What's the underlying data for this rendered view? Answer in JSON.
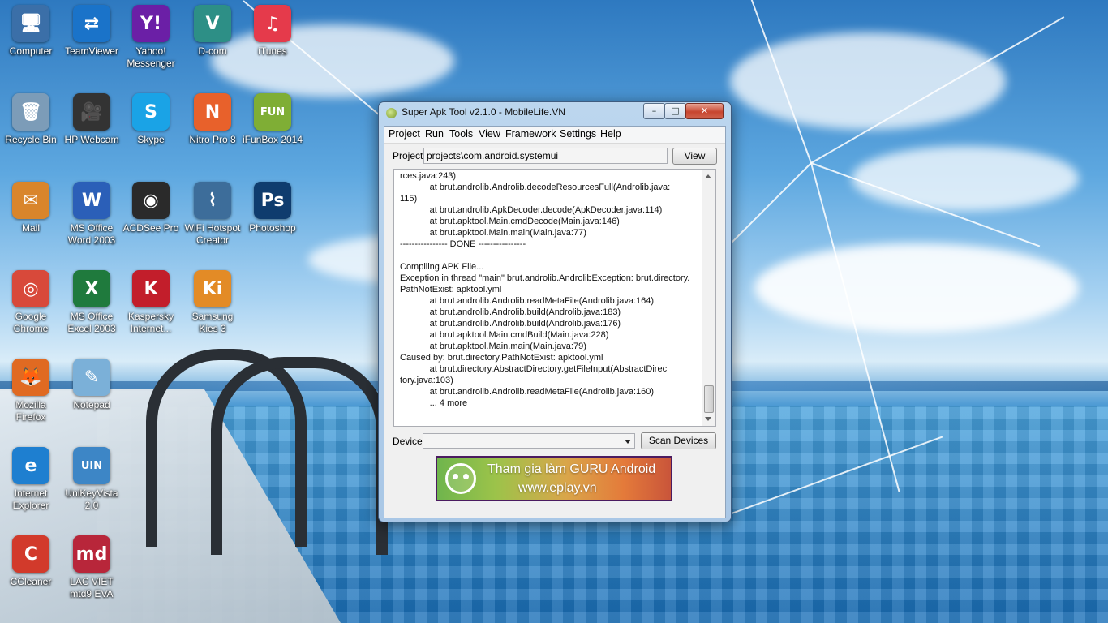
{
  "desktop": {
    "icons": [
      {
        "label": "Computer",
        "glyph": "🖥",
        "color": "#3b6fa8",
        "icon": "computer-icon"
      },
      {
        "label": "TeamViewer",
        "glyph": "⇄",
        "color": "#1a73c9",
        "icon": "teamviewer-icon"
      },
      {
        "label": "Yahoo!\nMessenger",
        "glyph": "Y!",
        "color": "#6b1fa6",
        "icon": "yahoo-messenger-icon"
      },
      {
        "label": "D-com",
        "glyph": "V",
        "color": "#2d8f86",
        "icon": "dcom-icon"
      },
      {
        "label": "iTunes",
        "glyph": "♫",
        "color": "#e53a4b",
        "icon": "itunes-icon"
      },
      {
        "label": "Recycle Bin",
        "glyph": "🗑",
        "color": "#7c9cb8",
        "icon": "recycle-bin-icon"
      },
      {
        "label": "HP Webcam",
        "glyph": "🎥",
        "color": "#333333",
        "icon": "webcam-icon"
      },
      {
        "label": "Skype",
        "glyph": "S",
        "color": "#1aa3e6",
        "icon": "skype-icon"
      },
      {
        "label": "Nitro Pro 8",
        "glyph": "N",
        "color": "#e8612b",
        "icon": "nitro-icon"
      },
      {
        "label": "iFunBox 2014",
        "glyph": "FUN",
        "color": "#7fae35",
        "icon": "ifunbox-icon"
      },
      {
        "label": "Mail",
        "glyph": "✉",
        "color": "#d9852b",
        "icon": "mail-icon"
      },
      {
        "label": "MS Office\nWord 2003",
        "glyph": "W",
        "color": "#2b5fb8",
        "icon": "word-icon"
      },
      {
        "label": "ACDSee Pro",
        "glyph": "◉",
        "color": "#2a2a2a",
        "icon": "acdsee-icon"
      },
      {
        "label": "WiFi Hotspot\nCreator",
        "glyph": "⌇",
        "color": "#3d6d9a",
        "icon": "wifi-hotspot-icon"
      },
      {
        "label": "Photoshop",
        "glyph": "Ps",
        "color": "#0f3c6e",
        "icon": "photoshop-icon"
      },
      {
        "label": "Google\nChrome",
        "glyph": "◎",
        "color": "#d8493a",
        "icon": "chrome-icon"
      },
      {
        "label": "MS Office\nExcel 2003",
        "glyph": "X",
        "color": "#1f7a3d",
        "icon": "excel-icon"
      },
      {
        "label": "Kaspersky\nInternet...",
        "glyph": "K",
        "color": "#c21e2b",
        "icon": "kaspersky-icon"
      },
      {
        "label": "Samsung\nKies 3",
        "glyph": "Ki",
        "color": "#e38b26",
        "icon": "kies-icon"
      },
      {
        "label": "Mozilla\nFirefox",
        "glyph": "🦊",
        "color": "#e06a22",
        "icon": "firefox-icon"
      },
      {
        "label": "Notepad",
        "glyph": "✎",
        "color": "#7bb0d8",
        "icon": "notepad-icon"
      },
      {
        "label": "Internet\nExplorer",
        "glyph": "e",
        "color": "#1e7fd0",
        "icon": "internet-explorer-icon"
      },
      {
        "label": "UniKeyVista\n2.0",
        "glyph": "UIN",
        "color": "#3d86c6",
        "icon": "unikey-icon"
      },
      {
        "label": "CCleaner",
        "glyph": "C",
        "color": "#d23a2b",
        "icon": "ccleaner-icon"
      },
      {
        "label": "LAC VIET\nmtd9 EVA",
        "glyph": "md",
        "color": "#b8263a",
        "icon": "lacviet-icon"
      }
    ]
  },
  "window": {
    "title": "Super Apk Tool v2.1.0 - MobileLife.VN",
    "controls": {
      "minimize": "–",
      "maximize": "□",
      "close": "✕"
    },
    "menu": [
      "Project",
      "Run",
      "Tools",
      "View",
      "Framework",
      "Settings",
      "Help"
    ],
    "project_label": "Project",
    "project_value": "projects\\com.android.systemui",
    "view_button": "View",
    "log_lines": [
      "rces.java:243)",
      "            at brut.androlib.Androlib.decodeResourcesFull(Androlib.java:",
      "115)",
      "            at brut.androlib.ApkDecoder.decode(ApkDecoder.java:114)",
      "            at brut.apktool.Main.cmdDecode(Main.java:146)",
      "            at brut.apktool.Main.main(Main.java:77)",
      "---------------- DONE ----------------",
      "",
      "Compiling APK File...",
      "Exception in thread \"main\" brut.androlib.AndrolibException: brut.directory.",
      "PathNotExist: apktool.yml",
      "            at brut.androlib.Androlib.readMetaFile(Androlib.java:164)",
      "            at brut.androlib.Androlib.build(Androlib.java:183)",
      "            at brut.androlib.Androlib.build(Androlib.java:176)",
      "            at brut.apktool.Main.cmdBuild(Main.java:228)",
      "            at brut.apktool.Main.main(Main.java:79)",
      "Caused by: brut.directory.PathNotExist: apktool.yml",
      "            at brut.directory.AbstractDirectory.getFileInput(AbstractDirec",
      "tory.java:103)",
      "            at brut.androlib.Androlib.readMetaFile(Androlib.java:160)",
      "            ... 4 more"
    ],
    "device_label": "Device",
    "device_value": "",
    "scan_button": "Scan Devices",
    "banner": {
      "line1": "Tham gia làm GURU Android",
      "line2": "www.eplay.vn"
    }
  }
}
